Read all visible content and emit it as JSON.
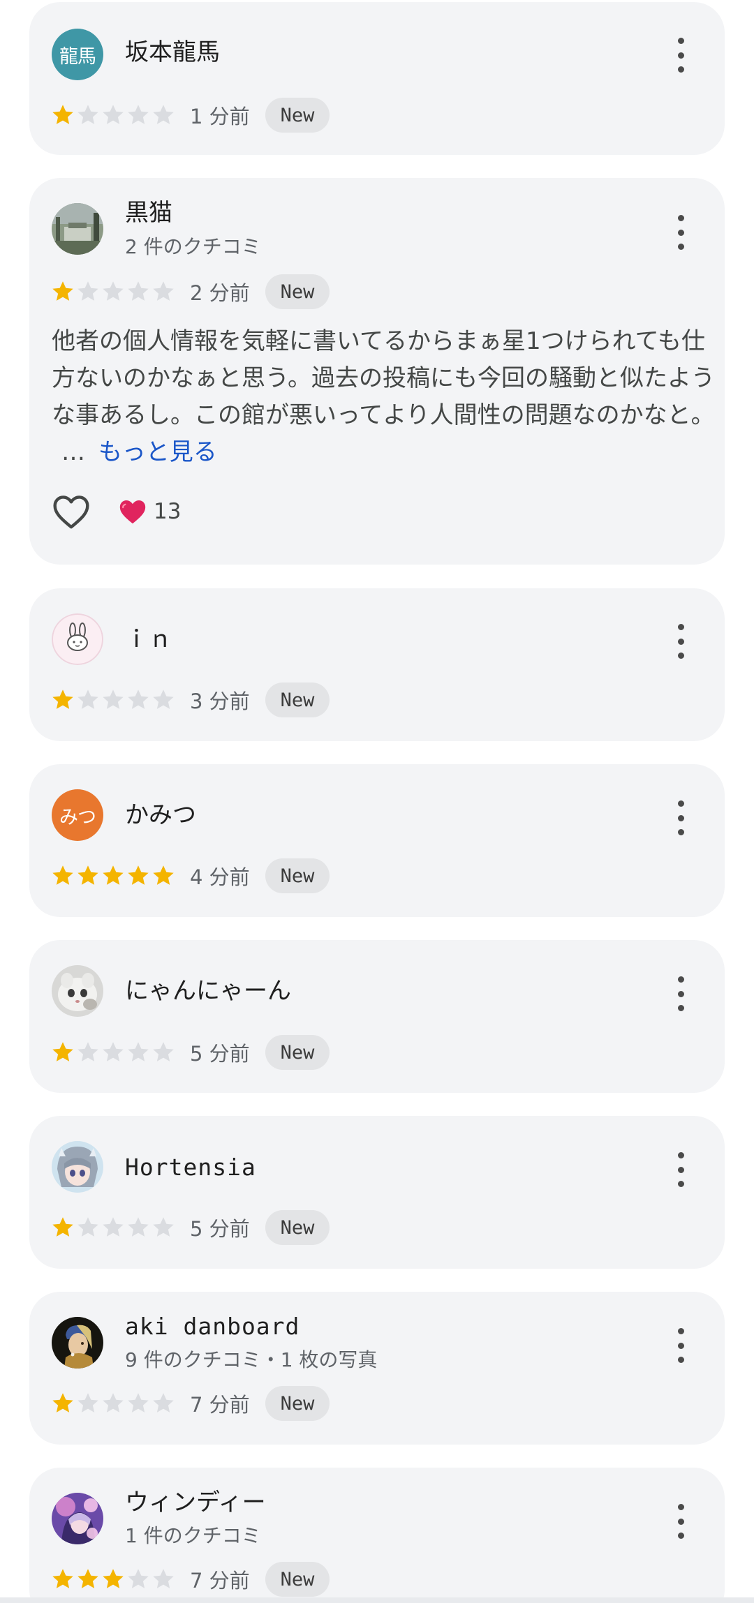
{
  "colors": {
    "card_bg": "#f3f4f6",
    "star_filled": "#f4b400",
    "star_empty": "#dadce0",
    "link": "#1a56c8",
    "heart": "#e0245e"
  },
  "reviews": [
    {
      "name": "坂本龍馬",
      "avatar_text": "龍馬",
      "avatar_color": "#3f97a6",
      "avatar_type": "text",
      "sub": "",
      "rating": 1,
      "time": "1 分前",
      "badge": "New"
    },
    {
      "name": "黒猫",
      "avatar_type": "photo-garden",
      "sub": "2 件のクチコミ",
      "rating": 1,
      "time": "2 分前",
      "badge": "New",
      "text": "他者の個人情報を気軽に書いてるからまぁ星1つけられても仕方ないのかなぁと思う。過去の投稿にも今回の騒動と似たような事あるし。この館が悪いってより人間性の問題なのかなと。",
      "ellipsis": "…",
      "more": "もっと見る",
      "reaction_count": "13"
    },
    {
      "name": "ｉｎ",
      "avatar_type": "bunny",
      "sub": "",
      "rating": 1,
      "time": "3 分前",
      "badge": "New"
    },
    {
      "name": "かみつ",
      "avatar_text": "みつ",
      "avatar_color": "#e8772e",
      "avatar_type": "text",
      "sub": "",
      "rating": 5,
      "time": "4 分前",
      "badge": "New"
    },
    {
      "name": "にゃんにゃーん",
      "avatar_type": "photo-cat",
      "sub": "",
      "rating": 1,
      "time": "5 分前",
      "badge": "New"
    },
    {
      "name": "Hortensia",
      "avatar_type": "anime",
      "sub": "",
      "rating": 1,
      "time": "5 分前",
      "badge": "New"
    },
    {
      "name": "aki danboard",
      "avatar_type": "painting",
      "sub": "9 件のクチコミ・1 枚の写真",
      "rating": 1,
      "time": "7 分前",
      "badge": "New"
    },
    {
      "name": "ウィンディー",
      "avatar_type": "anime-purple",
      "sub": "1 件のクチコミ",
      "rating": 3,
      "time": "7 分前",
      "badge": "New"
    }
  ]
}
